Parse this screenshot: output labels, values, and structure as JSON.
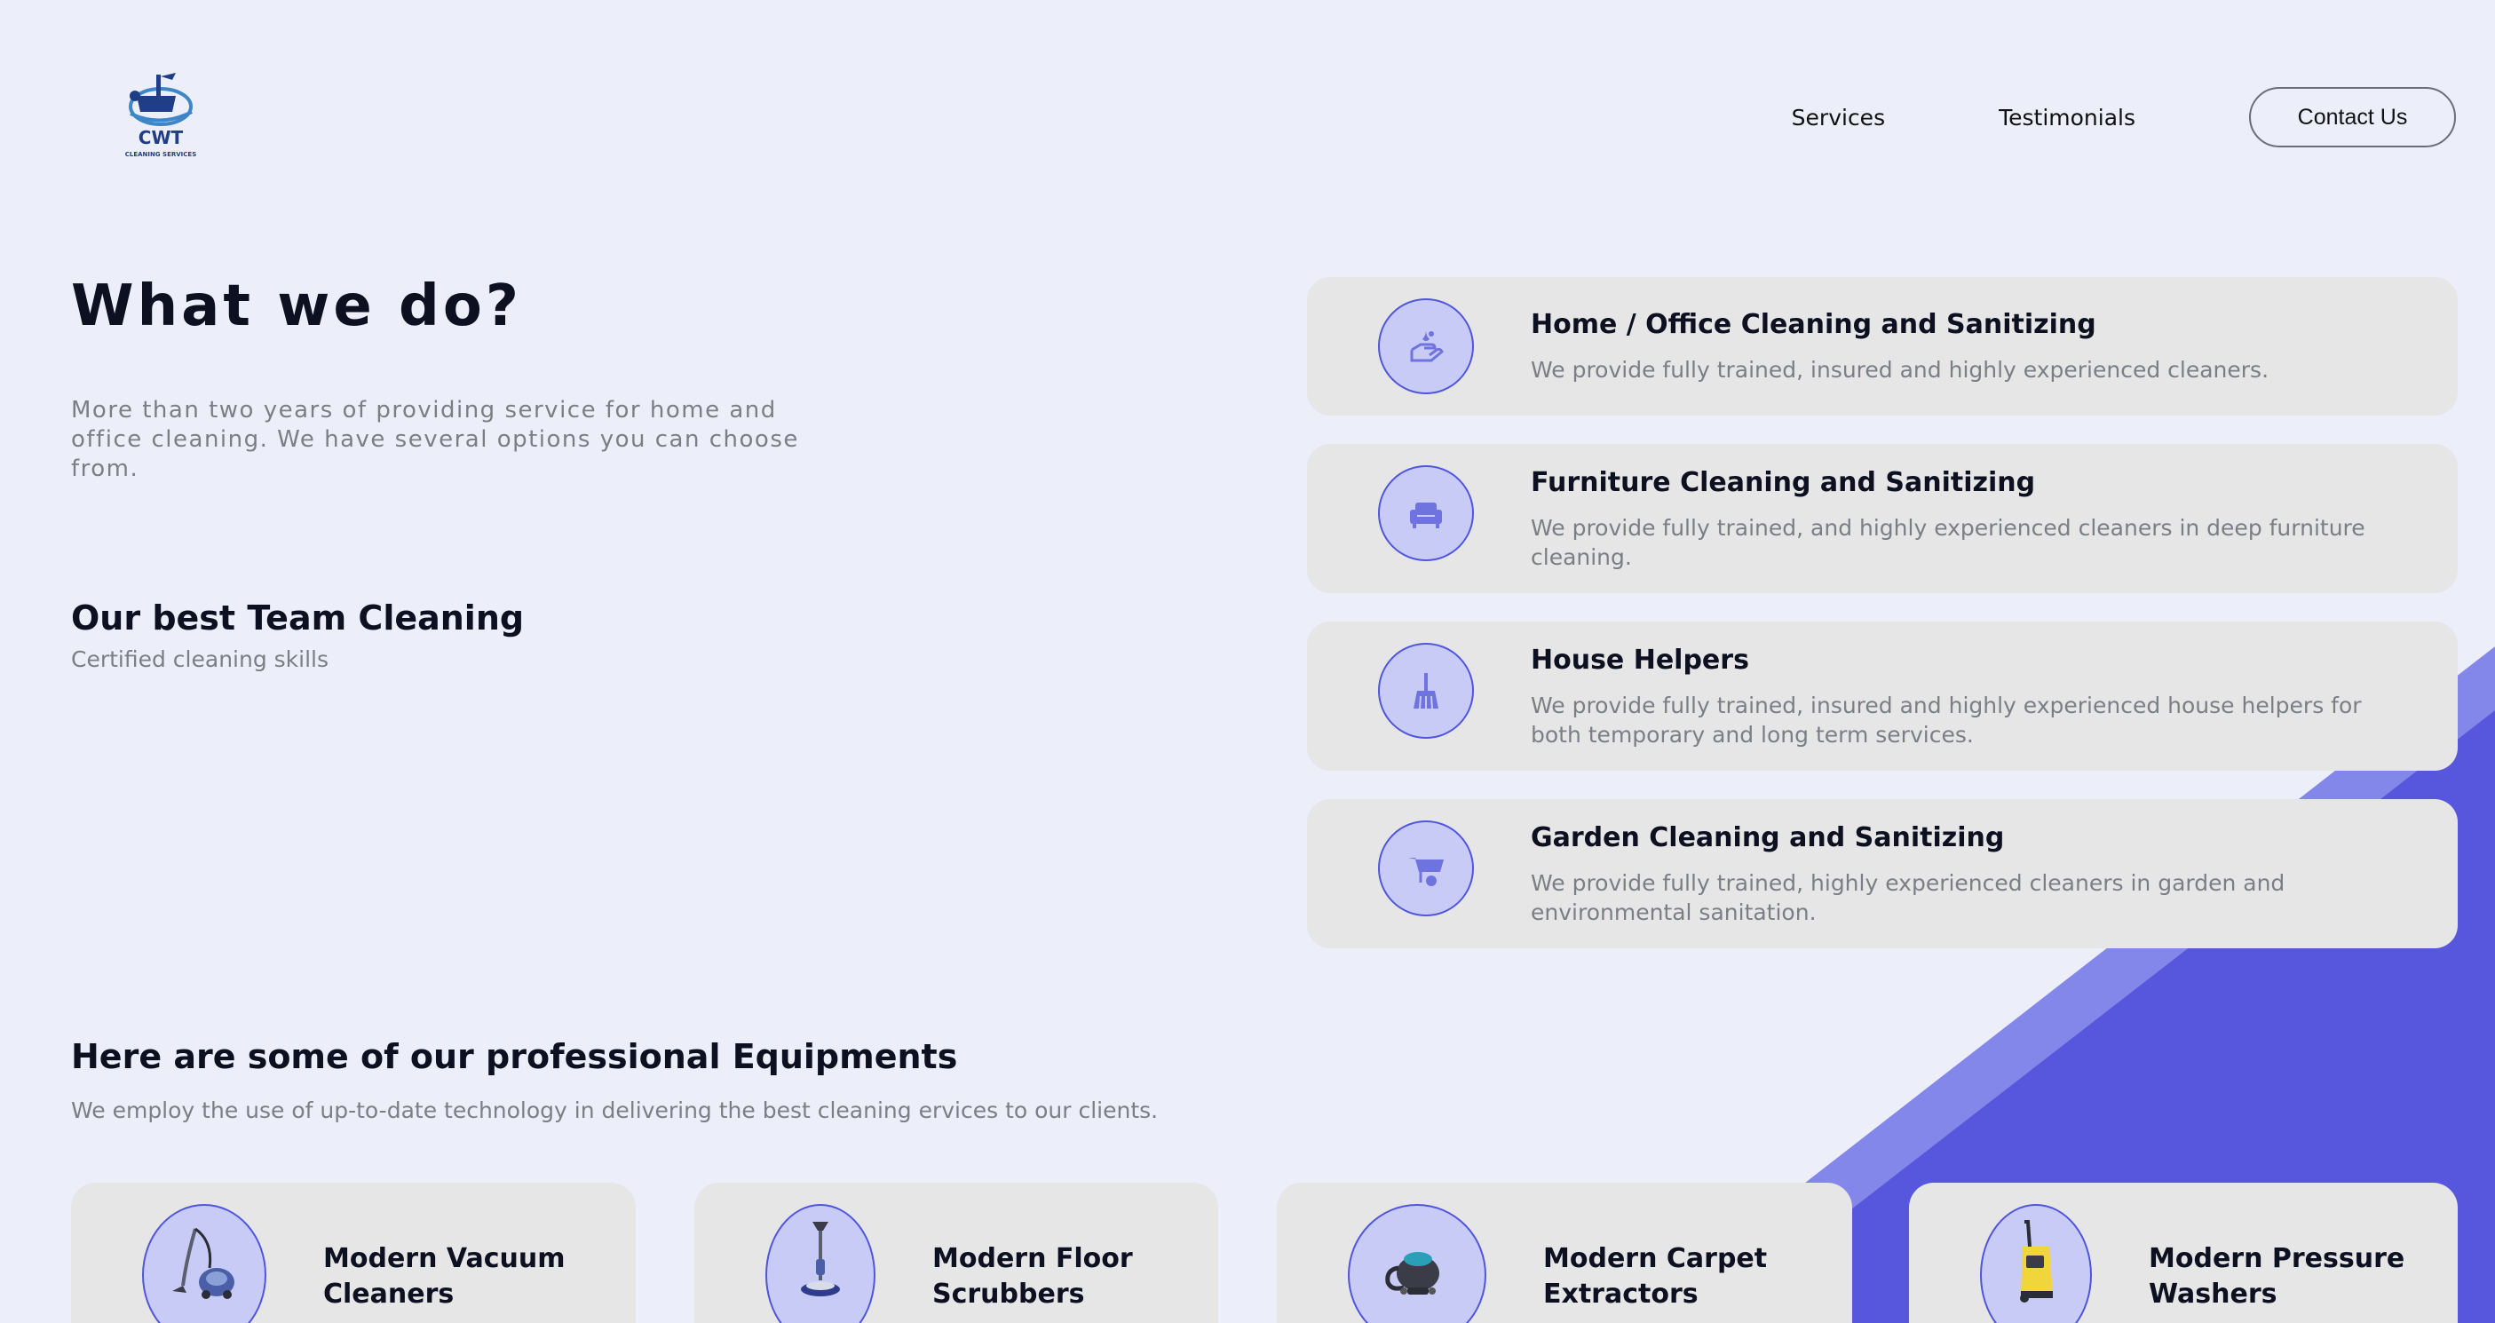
{
  "header": {
    "logo": {
      "text": "CWT",
      "subtext": "CLEANING SERVICES"
    },
    "nav": [
      {
        "label": "Services"
      },
      {
        "label": "Testimonials"
      }
    ],
    "contact_label": "Contact Us"
  },
  "intro": {
    "title": "What we do?",
    "description": "More than two years of providing service for home and office cleaning. We have several options you can choose from.",
    "team_title": "Our best Team Cleaning",
    "team_subtitle": "Certified cleaning skills"
  },
  "services": [
    {
      "icon": "hand-washing-icon",
      "title": "Home / Office Cleaning and Sanitizing",
      "description": "We provide fully trained, insured and highly experienced cleaners."
    },
    {
      "icon": "couch-icon",
      "title": "Furniture Cleaning and Sanitizing",
      "description": "We provide fully trained, and highly experienced cleaners in deep furniture cleaning."
    },
    {
      "icon": "broom-icon",
      "title": "House Helpers",
      "description": "We provide fully trained, insured and highly experienced house helpers for both temporary and long term services."
    },
    {
      "icon": "wheelbarrow-icon",
      "title": "Garden Cleaning and Sanitizing",
      "description": "We provide fully trained, highly experienced cleaners in garden and environmental sanitation."
    }
  ],
  "equipment": {
    "title": "Here are some of our professional Equipments",
    "subtitle": "We employ the use of up-to-date technology in delivering the best cleaning ervices to our clients.",
    "items": [
      {
        "name_line1": "Modern Vacuum",
        "name_line2": "Cleaners",
        "icon": "vacuum-cleaner-icon"
      },
      {
        "name_line1": "Modern Floor",
        "name_line2": "Scrubbers",
        "icon": "floor-scrubber-icon"
      },
      {
        "name_line1": "Modern Carpet",
        "name_line2": "Extractors",
        "icon": "carpet-extractor-icon"
      },
      {
        "name_line1": "Modern Pressure",
        "name_line2": "Washers",
        "icon": "pressure-washer-icon"
      }
    ]
  },
  "colors": {
    "background": "#eceffa",
    "card": "#e6e6e6",
    "accent": "#4f55dc",
    "accent_light": "#c8cbf6",
    "shape_light": "#8387e9",
    "shape_dark": "#5757de"
  }
}
